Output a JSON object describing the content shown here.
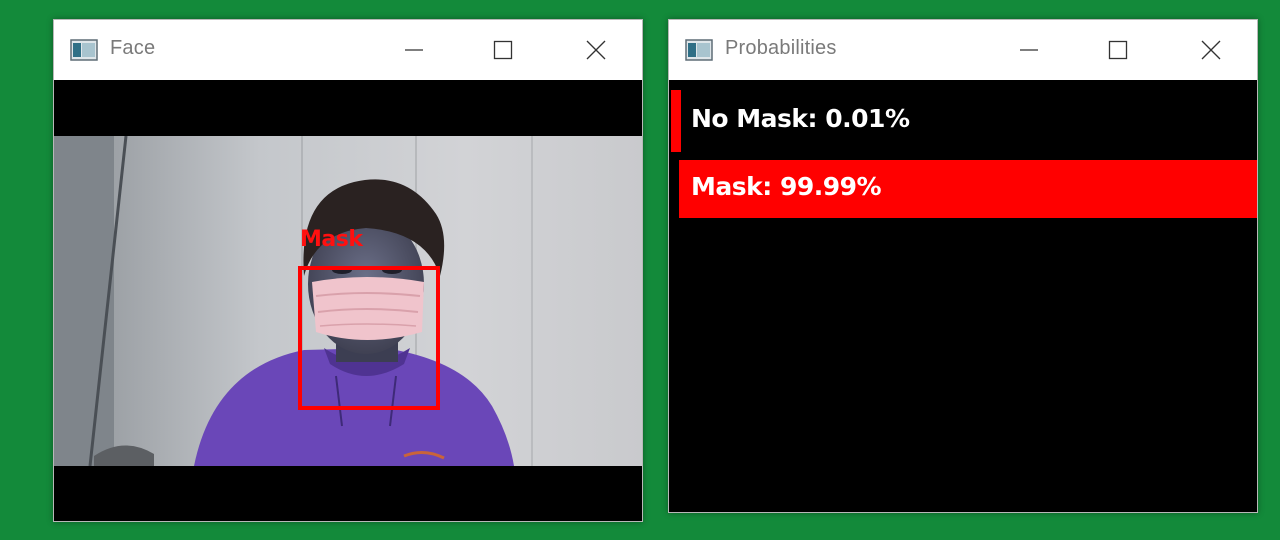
{
  "windows": {
    "face": {
      "title": "Face"
    },
    "probabilities": {
      "title": "Probabilities"
    }
  },
  "detection": {
    "label": "Mask",
    "box_color": "#ff0000"
  },
  "probabilities": {
    "rows": [
      {
        "label": "No Mask: 0.01%",
        "value": 0.0001
      },
      {
        "label": "Mask: 99.99%",
        "value": 0.9999
      }
    ],
    "bar_color": "#ff0000"
  },
  "colors": {
    "desktop": "#138a3a",
    "client_background": "#000000"
  },
  "icons": {
    "app": "app-window-icon",
    "minimize": "minimize-icon",
    "maximize": "maximize-icon",
    "close": "close-icon"
  }
}
